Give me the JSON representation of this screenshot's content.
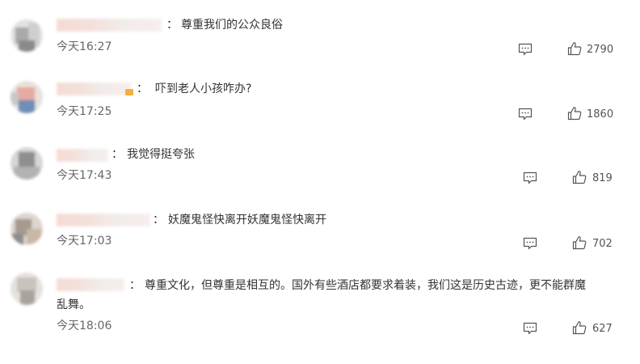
{
  "comments": [
    {
      "text": "尊重我们的公众良俗",
      "time": "今天16:27",
      "likes": "2790"
    },
    {
      "text": "吓到老人小孩咋办?",
      "time": "今天17:25",
      "likes": "1860"
    },
    {
      "text": "我觉得挺夸张",
      "time": "今天17:43",
      "likes": "819"
    },
    {
      "text": "妖魔鬼怪快离开妖魔鬼怪快离开",
      "time": "今天17:03",
      "likes": "702"
    },
    {
      "text_line1": "尊重文化，但尊重是相互的。国外有些酒店都要求着装，我们这是历史古迹，更不能群魔",
      "text_line2": "乱舞。",
      "time": "今天18:06",
      "likes": "627"
    }
  ],
  "icons": {
    "reply": "comment-icon",
    "like": "thumbs-up-icon"
  }
}
